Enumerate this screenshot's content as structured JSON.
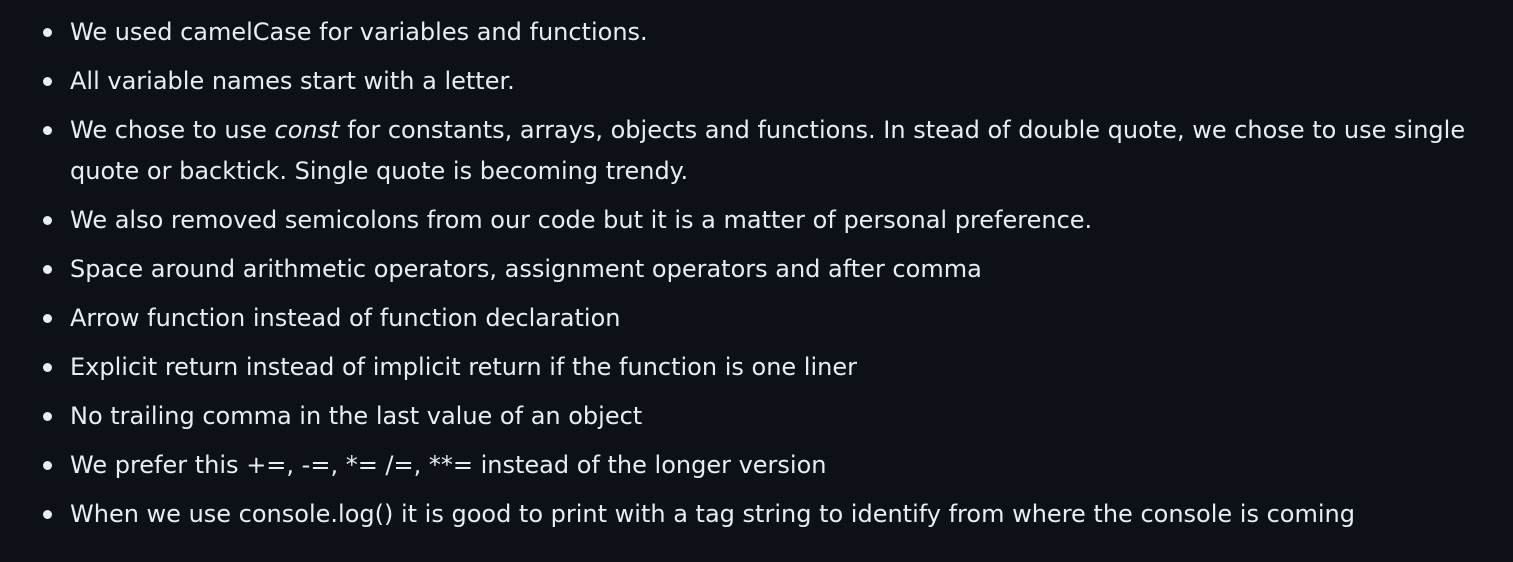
{
  "bullets": {
    "items": [
      {
        "text": "We used camelCase for variables and functions."
      },
      {
        "text": "All variable names start with a letter."
      },
      {
        "before": "We chose to use ",
        "emphasis": "const",
        "after": " for constants, arrays, objects and functions. In stead of double quote, we chose to use single quote or backtick. Single quote is becoming trendy."
      },
      {
        "text": "We also removed semicolons from our code but it is a matter of personal preference."
      },
      {
        "text": "Space around arithmetic operators, assignment operators and after comma"
      },
      {
        "text": "Arrow function instead of function declaration"
      },
      {
        "text": "Explicit return instead of implicit return if the function is one liner"
      },
      {
        "text": "No trailing comma in the last value of an object"
      },
      {
        "text": "We prefer this +=, -=, *= /=, **= instead of the longer version"
      },
      {
        "text": "When we use console.log() it is good to print with a tag string to identify from where the console is coming"
      }
    ]
  }
}
